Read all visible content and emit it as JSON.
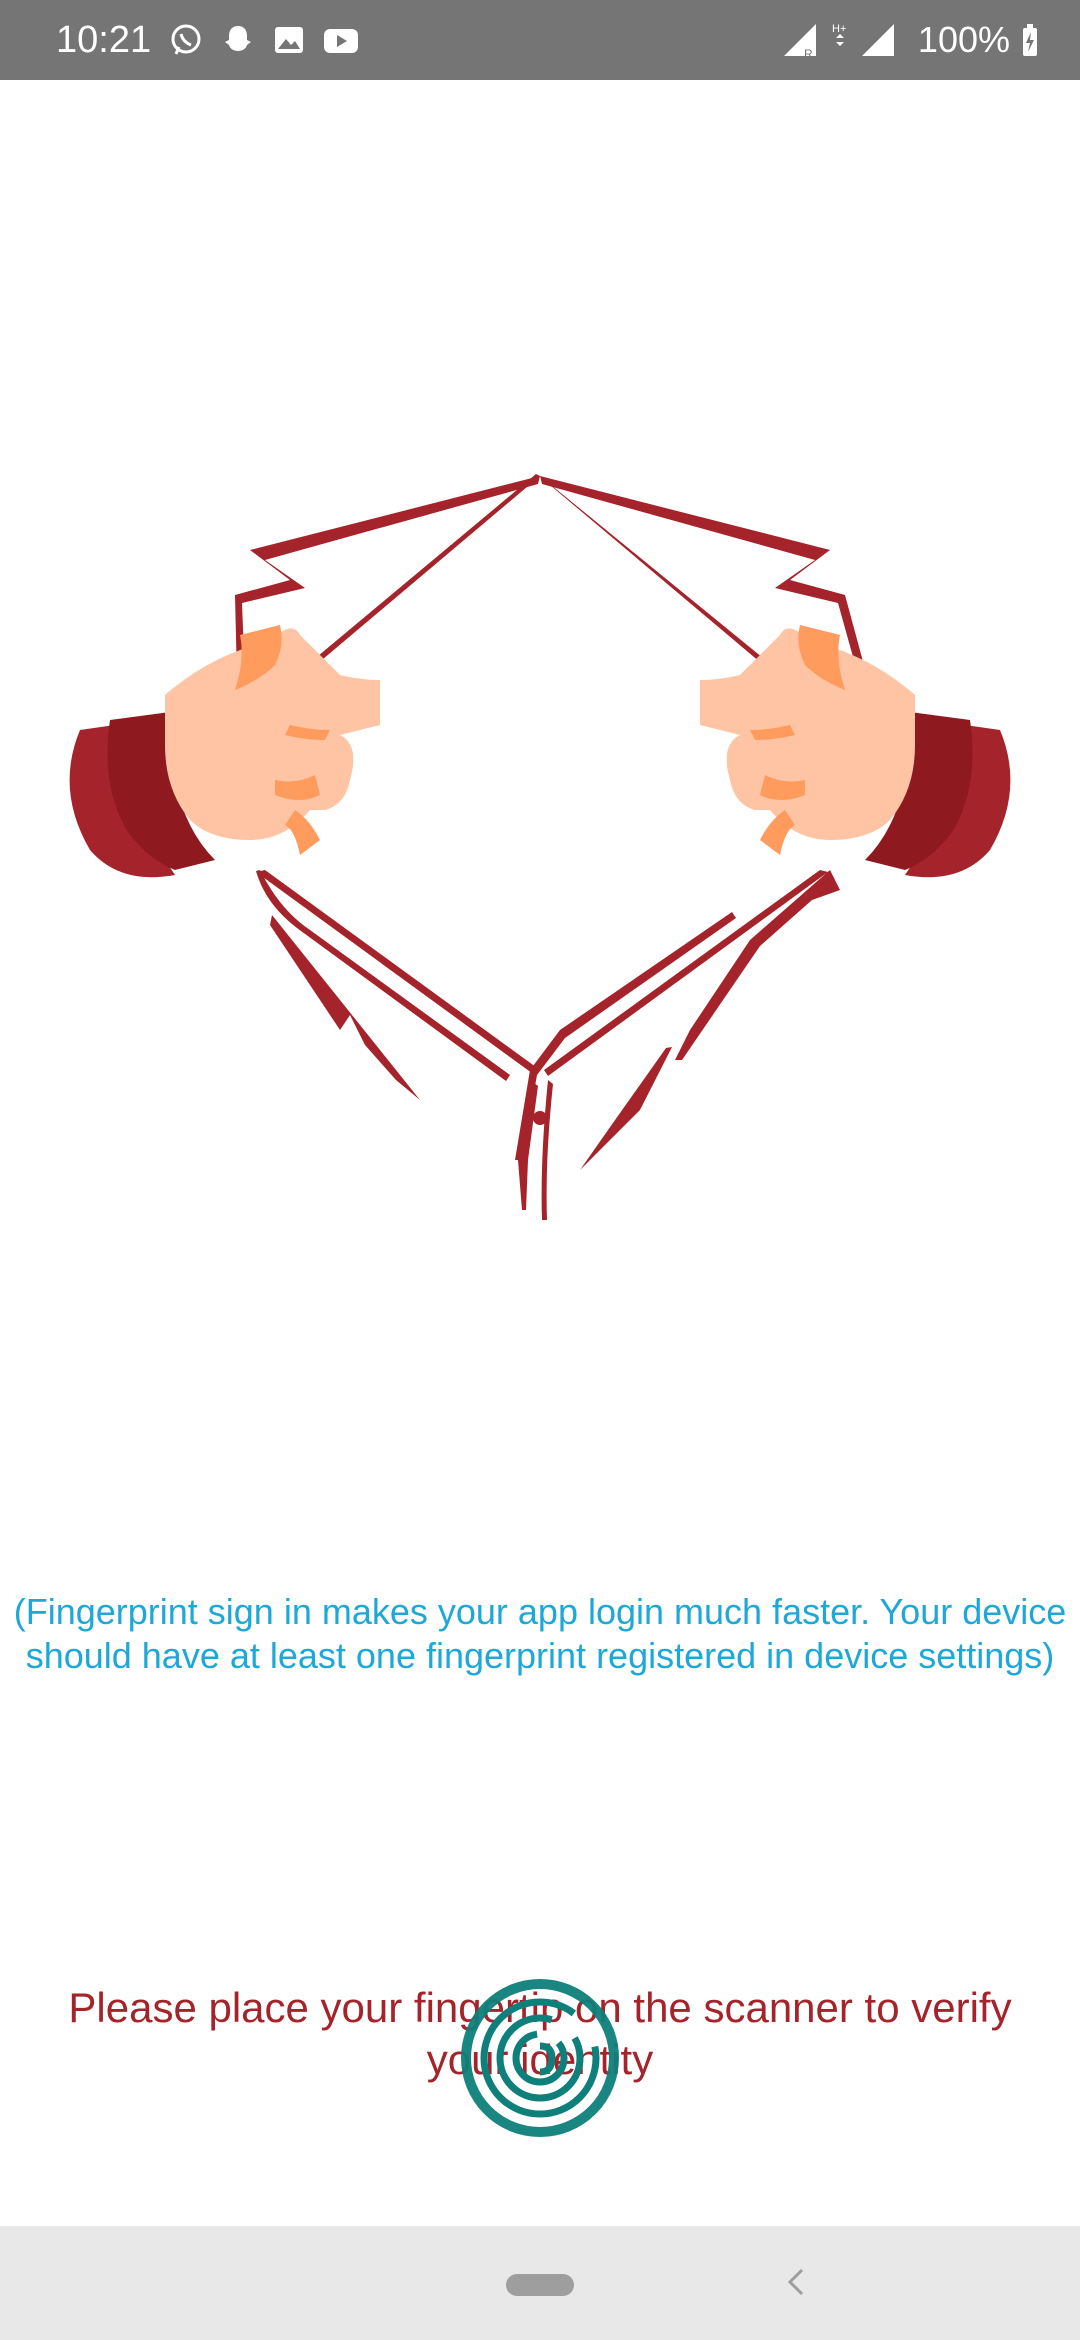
{
  "status_bar": {
    "time": "10:21",
    "battery": "100%",
    "icons_left": [
      "whatsapp-icon",
      "snapchat-icon",
      "gallery-icon",
      "youtube-icon"
    ],
    "icons_right": [
      "signal-r-icon",
      "hplus-icon",
      "signal-icon",
      "battery-charging-icon"
    ],
    "background": "#757575"
  },
  "main": {
    "info_text": "(Fingerprint sign in makes your app login much faster. Your device should have at least one fingerprint registered in device settings)",
    "instruction_text": "Please place your fingertip on the scanner to verify your identity",
    "illustration_icon": "shirt-open-hands-illustration",
    "fingerprint_icon": "fingerprint-icon",
    "info_color": "#1EA8D8",
    "instruction_color": "#A5232A",
    "accent_color": "#0E7F7A"
  },
  "nav_bar": {
    "home_icon": "home-pill-icon",
    "back_icon": "back-chevron-icon"
  }
}
